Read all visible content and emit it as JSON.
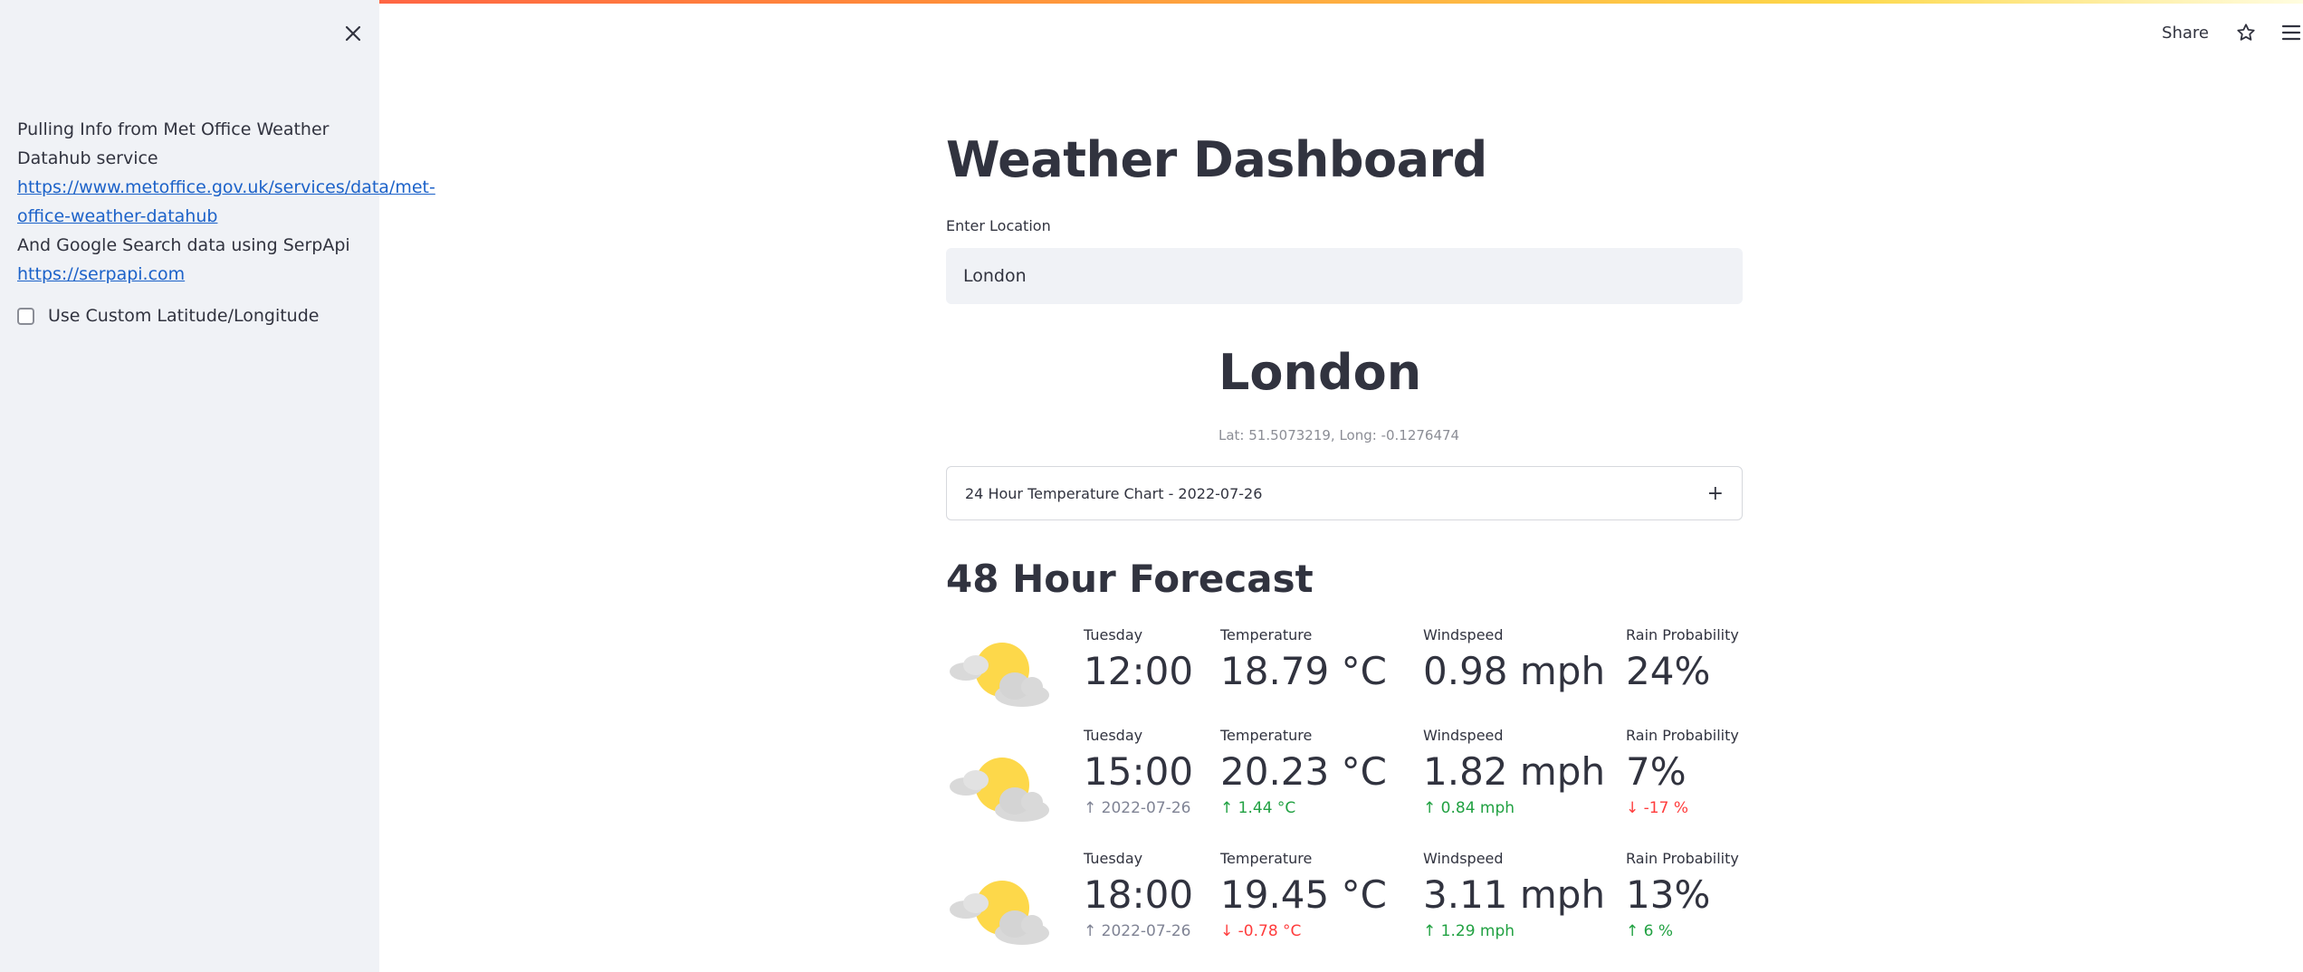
{
  "sidebar": {
    "text_line1": "Pulling Info from Met Office Weather Datahub service",
    "link1": "https://www.metoffice.gov.uk/services/data/met-office-weather-datahub",
    "text_line2": "And Google Search data using SerpApi",
    "link2": "https://serpapi.com",
    "checkbox_label": "Use Custom Latitude/Longitude",
    "checkbox_checked": false
  },
  "header": {
    "share_label": "Share"
  },
  "main": {
    "title": "Weather Dashboard",
    "location_label": "Enter Location",
    "location_value": "London",
    "city": "London",
    "latlong": "Lat: 51.5073219, Long: -0.1276474",
    "expander_label": "24 Hour Temperature Chart - 2022-07-26",
    "expander_icon": "+",
    "forecast_title": "48 Hour Forecast",
    "forecast": [
      {
        "day": "Tuesday",
        "time": "12:00",
        "temp_label": "Temperature",
        "temp": "18.79 °C",
        "wind_label": "Windspeed",
        "wind": "0.98 mph",
        "rain_label": "Rain Probability",
        "rain": "24%"
      },
      {
        "day": "Tuesday",
        "time": "15:00",
        "time_delta": "2022-07-26",
        "temp_label": "Temperature",
        "temp": "20.23 °C",
        "temp_delta": "1.44 °C",
        "wind_label": "Windspeed",
        "wind": "1.82 mph",
        "wind_delta": "0.84 mph",
        "rain_label": "Rain Probability",
        "rain": "7%",
        "rain_delta": "-17 %"
      },
      {
        "day": "Tuesday",
        "time": "18:00",
        "time_delta": "2022-07-26",
        "temp_label": "Temperature",
        "temp": "19.45 °C",
        "temp_delta": "-0.78 °C",
        "wind_label": "Windspeed",
        "wind": "3.11 mph",
        "wind_delta": "1.29 mph",
        "rain_label": "Rain Probability",
        "rain": "13%",
        "rain_delta": "6 %"
      }
    ]
  },
  "colors": {
    "accent_red": "#ff4b4b",
    "delta_green": "#21a142",
    "delta_red": "#ff3c3c",
    "link": "#1c62c9",
    "sidebar_bg": "#f0f2f6"
  },
  "icons": [
    "close-icon",
    "star-icon",
    "hamburger-menu-icon",
    "sun-cloud-icon",
    "arrow-up-icon",
    "arrow-down-icon",
    "plus-icon"
  ]
}
